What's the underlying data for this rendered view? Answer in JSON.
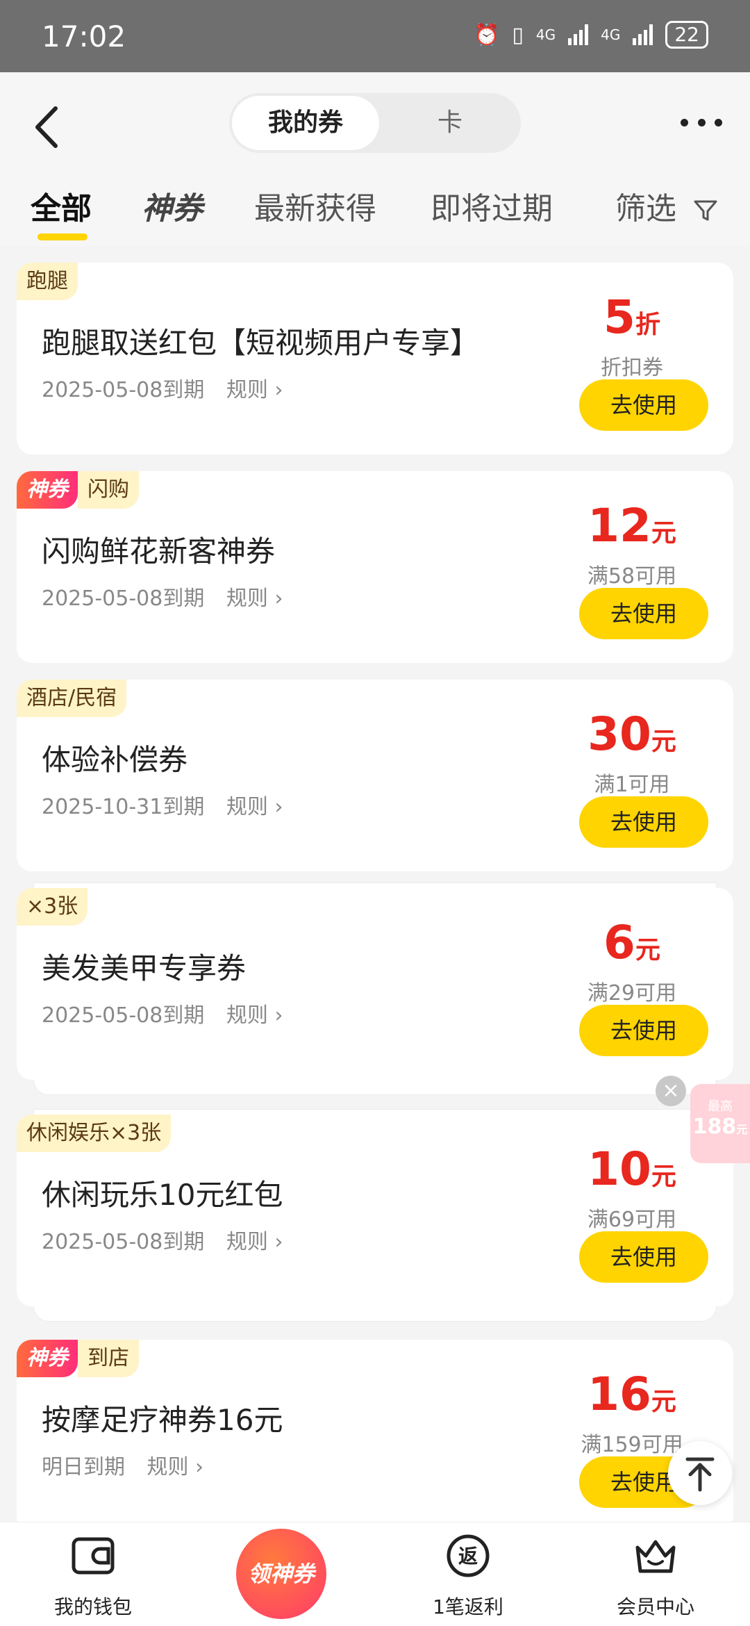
{
  "status": {
    "time": "17:02",
    "net1": "4G",
    "net2": "4G",
    "battery": "22"
  },
  "header": {
    "segments": {
      "active": "我的券",
      "inactive": "卡"
    },
    "tabs": [
      "全部",
      "神券",
      "最新获得",
      "即将过期",
      "筛选"
    ]
  },
  "coupons": [
    {
      "tags": [
        "跑腿"
      ],
      "god": false,
      "title": "跑腿取送红包【短视频用户专享】",
      "expiry": "2025-05-08到期",
      "rule": "规则",
      "amount": "5",
      "unit": "折",
      "condition": "折扣券",
      "button": "去使用"
    },
    {
      "tags": [
        "闪购"
      ],
      "god": true,
      "title": "闪购鲜花新客神券",
      "expiry": "2025-05-08到期",
      "rule": "规则",
      "amount": "12",
      "unit": "元",
      "condition": "满58可用",
      "button": "去使用"
    },
    {
      "tags": [
        "酒店/民宿"
      ],
      "god": false,
      "title": "体验补偿券",
      "expiry": "2025-10-31到期",
      "rule": "规则",
      "amount": "30",
      "unit": "元",
      "condition": "满1可用",
      "button": "去使用"
    },
    {
      "tags": [
        "×3张"
      ],
      "god": false,
      "title": "美发美甲专享券",
      "expiry": "2025-05-08到期",
      "rule": "规则",
      "amount": "6",
      "unit": "元",
      "condition": "满29可用",
      "button": "去使用"
    },
    {
      "tags": [
        "休闲娱乐×3张"
      ],
      "god": false,
      "title": "休闲玩乐10元红包",
      "expiry": "2025-05-08到期",
      "rule": "规则",
      "amount": "10",
      "unit": "元",
      "condition": "满69可用",
      "button": "去使用"
    },
    {
      "tags": [
        "到店"
      ],
      "god": true,
      "title": "按摩足疗神券16元",
      "expiry": "明日到期",
      "rule": "规则",
      "amount": "16",
      "unit": "元",
      "condition": "满159可用",
      "button": "去使用"
    }
  ],
  "god_tag": "神券",
  "float": {
    "top": "最高",
    "value": "188",
    "unit": "元"
  },
  "bottom_nav": {
    "wallet": "我的钱包",
    "center": "领神券",
    "rebate": "1笔返利",
    "rebate_icon": "返",
    "member": "会员中心"
  },
  "colors": {
    "accent": "#ffd400",
    "price": "#e8271e"
  }
}
